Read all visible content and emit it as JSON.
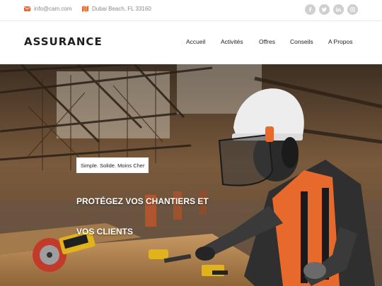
{
  "topbar": {
    "email": "info@cam.com",
    "address": "Dubai Beach, FL 33160",
    "socials": [
      "facebook-icon",
      "twitter-icon",
      "linkedin-icon",
      "instagram-icon"
    ]
  },
  "brand": "ASSURANCE",
  "nav": [
    "Accueil",
    "Activités",
    "Offres",
    "Conseils",
    "A Propos"
  ],
  "hero": {
    "tagline": "Simple. Solide. Moins Cher",
    "title_line1": "PROTÉGEZ VOS CHANTIERS ET",
    "title_line2": "VOS CLIENTS"
  },
  "colors": {
    "accent": "#e8692c",
    "text_dark": "#1f1f1f",
    "muted": "#8a8a8a",
    "social_bg": "#cfcfcf"
  }
}
